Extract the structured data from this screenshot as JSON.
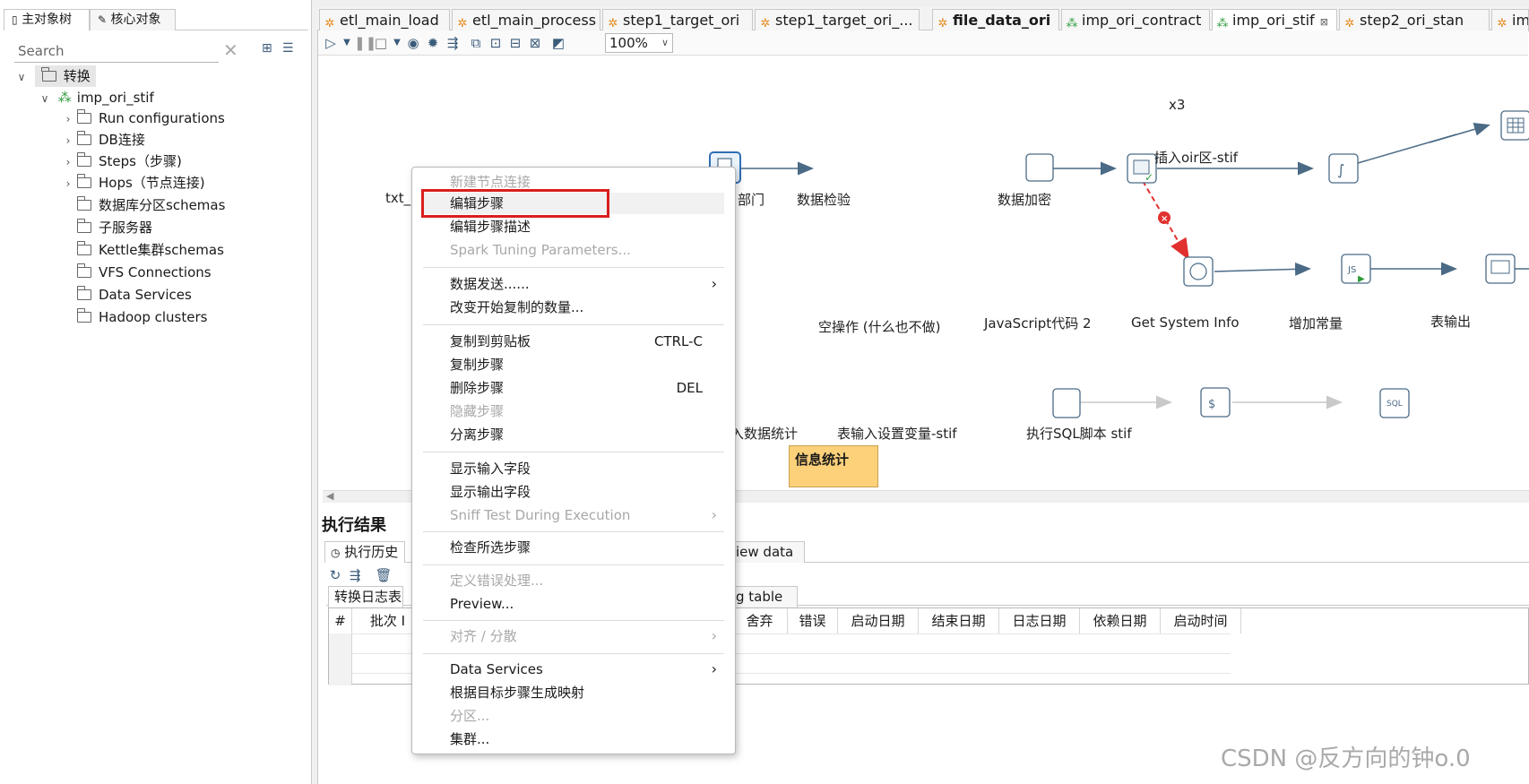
{
  "left_panel": {
    "tabs": [
      "主对象树",
      "核心对象"
    ],
    "search_placeholder": "Search",
    "tree": {
      "root": "转换",
      "transformation": "imp_ori_stif",
      "items": [
        "Run configurations",
        "DB连接",
        "Steps（步骤)",
        "Hops（节点连接)",
        "数据库分区schemas",
        "子服务器",
        "Kettle集群schemas",
        "VFS Connections",
        "Data Services",
        "Hadoop clusters"
      ]
    }
  },
  "file_tabs": [
    {
      "label": "etl_main_load",
      "icon": "orange"
    },
    {
      "label": "etl_main_process",
      "icon": "orange"
    },
    {
      "label": "step1_target_ori",
      "icon": "orange"
    },
    {
      "label": "step1_target_ori_...",
      "icon": "orange"
    },
    {
      "label": "file_data_ori",
      "icon": "orange"
    },
    {
      "label": "imp_ori_contract",
      "icon": "green"
    },
    {
      "label": "imp_ori_stif",
      "icon": "green",
      "active": true
    },
    {
      "label": "step2_ori_stan",
      "icon": "orange"
    },
    {
      "label": "imp",
      "icon": "orange"
    }
  ],
  "toolbar": {
    "zoom": "100%"
  },
  "canvas": {
    "steps": {
      "txt": "txt_",
      "dept": "部门",
      "data_check": "数据检验",
      "data_encrypt": "数据加密",
      "insert_oir": "插入oir区-stif",
      "copies": "x3",
      "dummy": "空操作 (什么也不做)",
      "javascript": "JavaScript代码 2",
      "sysinfo": "Get System Info",
      "add_const": "增加常量",
      "table_out": "表输出",
      "stat": "入数据统计",
      "table_input_var": "表输入设置变量-stif",
      "exec_sql": "执行SQL脚本 stif"
    },
    "note": "信息统计"
  },
  "exec": {
    "title": "执行结果",
    "tabs": [
      "执行历史",
      "iew data"
    ],
    "log_tabs": [
      "转换日志表",
      "g table"
    ],
    "columns": [
      "#",
      "批次 I",
      "舍弃",
      "错误",
      "启动日期",
      "结束日期",
      "日志日期",
      "依赖日期",
      "启动时间"
    ]
  },
  "context_menu": {
    "items": [
      {
        "label": "新建节点连接",
        "disabled": true
      },
      {
        "label": "编辑步骤",
        "highlighted": true
      },
      {
        "label": "编辑步骤描述"
      },
      {
        "label": "Spark Tuning Parameters...",
        "disabled": true
      },
      {
        "label": "数据发送......",
        "submenu": true
      },
      {
        "label": "改变开始复制的数量..."
      },
      {
        "label": "复制到剪贴板",
        "shortcut": "CTRL-C"
      },
      {
        "label": "复制步骤"
      },
      {
        "label": "删除步骤",
        "shortcut": "DEL"
      },
      {
        "label": "隐藏步骤",
        "disabled": true
      },
      {
        "label": "分离步骤"
      },
      {
        "label": "显示输入字段"
      },
      {
        "label": "显示输出字段"
      },
      {
        "label": "Sniff Test During Execution",
        "disabled": true,
        "submenu": true
      },
      {
        "label": "检查所选步骤"
      },
      {
        "label": "定义错误处理...",
        "disabled": true
      },
      {
        "label": "Preview..."
      },
      {
        "label": "对齐 / 分散",
        "disabled": true,
        "submenu": true
      },
      {
        "label": "Data Services",
        "submenu": true
      },
      {
        "label": "根据目标步骤生成映射"
      },
      {
        "label": "分区...",
        "disabled": true
      },
      {
        "label": "集群..."
      }
    ],
    "highlight_color": "#d91e1e"
  },
  "watermark": "CSDN @反方向的钟o.0"
}
